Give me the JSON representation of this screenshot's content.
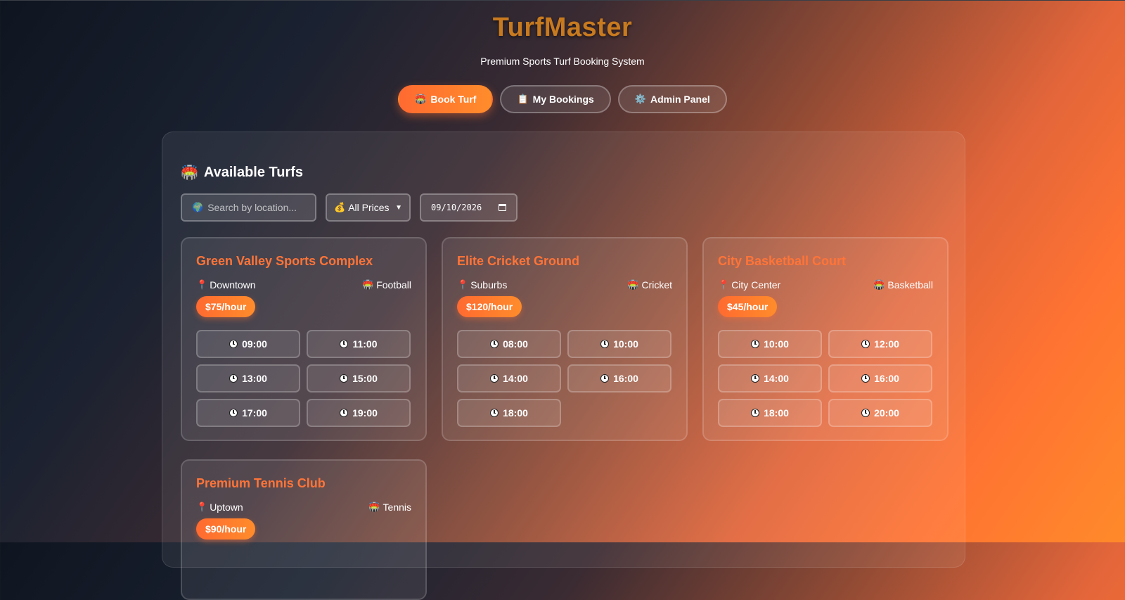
{
  "header": {
    "brand": "TurfMaster",
    "tagline": "Premium Sports Turf Booking System"
  },
  "nav": [
    {
      "label": "Book Turf",
      "icon": "stadium-icon",
      "active": true
    },
    {
      "label": "My Bookings",
      "icon": "clipboard-icon",
      "active": false
    },
    {
      "label": "Admin Panel",
      "icon": "gear-icon",
      "active": false
    }
  ],
  "section": {
    "title": "Available Turfs",
    "icon": "stadium-icon"
  },
  "filters": {
    "search_placeholder": "Search by location...",
    "price_selected": "All Prices",
    "date_value": "09/10/2026"
  },
  "turfs": [
    {
      "name": "Green Valley Sports Complex",
      "location": "Downtown",
      "sport": "Football",
      "price": "$75/hour",
      "slots": [
        "09:00",
        "11:00",
        "13:00",
        "15:00",
        "17:00",
        "19:00"
      ]
    },
    {
      "name": "Elite Cricket Ground",
      "location": "Suburbs",
      "sport": "Cricket",
      "price": "$120/hour",
      "slots": [
        "08:00",
        "10:00",
        "14:00",
        "16:00",
        "18:00"
      ]
    },
    {
      "name": "City Basketball Court",
      "location": "City Center",
      "sport": "Basketball",
      "price": "$45/hour",
      "slots": [
        "10:00",
        "12:00",
        "14:00",
        "16:00",
        "18:00",
        "20:00"
      ]
    },
    {
      "name": "Premium Tennis Club",
      "location": "Uptown",
      "sport": "Tennis",
      "price": "$90/hour",
      "slots": []
    }
  ],
  "colors": {
    "accent": "#ff7438",
    "brand": "#c87a1f"
  }
}
